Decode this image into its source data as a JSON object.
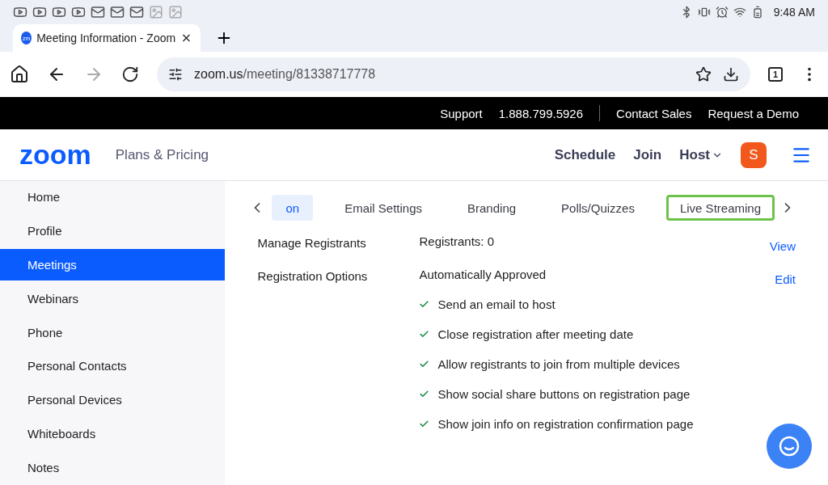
{
  "status_bar": {
    "time": "9:48 AM"
  },
  "browser": {
    "tab_title": "Meeting Information - Zoom",
    "favicon": "zm",
    "url_host": "zoom.us",
    "url_path": "/meeting/81338717778",
    "tab_count": "1"
  },
  "top_bar": {
    "links": [
      "Support",
      "1.888.799.5926",
      "Contact Sales",
      "Request a Demo"
    ]
  },
  "nav": {
    "logo": "zoom",
    "links": [
      "Plans & Pricing"
    ],
    "actions": [
      "Schedule",
      "Join",
      "Host"
    ],
    "avatar": "S"
  },
  "sidebar": {
    "items": [
      {
        "label": "Home",
        "selected": false
      },
      {
        "label": "Profile",
        "selected": false
      },
      {
        "label": "Meetings",
        "selected": true
      },
      {
        "label": "Webinars",
        "selected": false
      },
      {
        "label": "Phone",
        "selected": false
      },
      {
        "label": "Personal Contacts",
        "selected": false
      },
      {
        "label": "Personal Devices",
        "selected": false
      },
      {
        "label": "Whiteboards",
        "selected": false
      },
      {
        "label": "Notes",
        "selected": false
      }
    ]
  },
  "tabs": [
    {
      "label": "on",
      "selected": true,
      "highlighted": false
    },
    {
      "label": "Email Settings",
      "selected": false,
      "highlighted": false
    },
    {
      "label": "Branding",
      "selected": false,
      "highlighted": false
    },
    {
      "label": "Polls/Quizzes",
      "selected": false,
      "highlighted": false
    },
    {
      "label": "Live Streaming",
      "selected": false,
      "highlighted": true
    }
  ],
  "rows": [
    {
      "label": "Manage Registrants",
      "value": "Registrants: 0",
      "action": "View",
      "options": []
    },
    {
      "label": "Registration Options",
      "value": "Automatically Approved",
      "action": "Edit",
      "options": [
        {
          "label": "Send an email to host",
          "checked": true
        },
        {
          "label": "Close registration after meeting date",
          "checked": true
        },
        {
          "label": "Allow registrants to join from multiple devices",
          "checked": true
        },
        {
          "label": "Show social share buttons on registration page",
          "checked": true
        },
        {
          "label": "Show join info on registration confirmation page",
          "checked": true
        }
      ]
    }
  ]
}
